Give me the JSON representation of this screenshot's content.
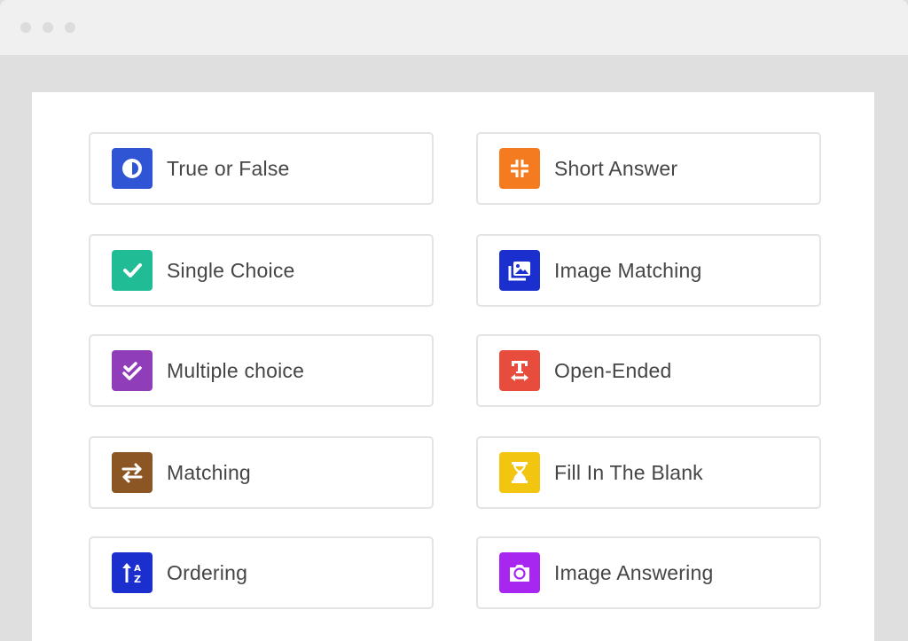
{
  "window": {
    "controls": [
      "window-dot",
      "window-dot",
      "window-dot"
    ]
  },
  "question_types": [
    {
      "label": "True or False",
      "icon": "half-circle-icon",
      "color": "#2f55d4"
    },
    {
      "label": "Short Answer",
      "icon": "compress-icon",
      "color": "#f47b20"
    },
    {
      "label": "Single Choice",
      "icon": "check-icon",
      "color": "#1fbc95"
    },
    {
      "label": "Image Matching",
      "icon": "images-icon",
      "color": "#1b2fcf"
    },
    {
      "label": "Multiple choice",
      "icon": "double-check-icon",
      "color": "#8f3db8"
    },
    {
      "label": "Open-Ended",
      "icon": "text-width-icon",
      "color": "#e74c3c"
    },
    {
      "label": "Matching",
      "icon": "exchange-arrows-icon",
      "color": "#8b5524"
    },
    {
      "label": "Fill In The Blank",
      "icon": "hourglass-icon",
      "color": "#f2c511"
    },
    {
      "label": "Ordering",
      "icon": "sort-alpha-up-icon",
      "color": "#1b2fcf"
    },
    {
      "label": "Image Answering",
      "icon": "camera-icon",
      "color": "#a727f0"
    }
  ]
}
